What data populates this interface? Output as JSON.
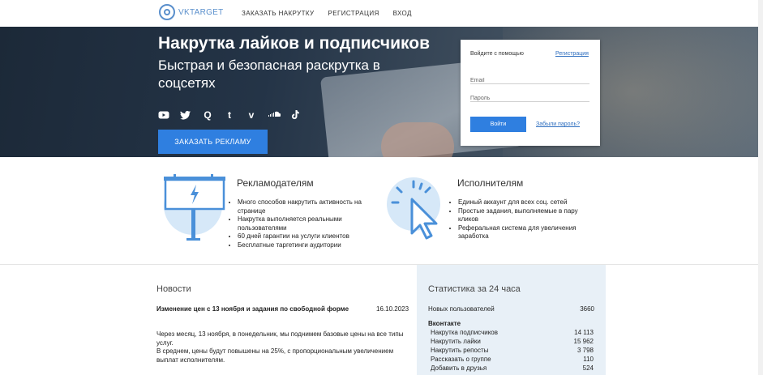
{
  "header": {
    "logo_text": "VKTARGET",
    "nav": [
      "ЗАКАЗАТЬ НАКРУТКУ",
      "РЕГИСТРАЦИЯ",
      "ВХОД"
    ]
  },
  "hero": {
    "title": "Накрутка лайков и подписчиков",
    "subtitle": "Быстрая и безопасная раскрутка в соцсетях",
    "socials": [
      "youtube-icon",
      "twitter-icon",
      "quora-icon",
      "tumblr-icon",
      "vimeo-icon",
      "soundcloud-icon",
      "tiktok-icon"
    ],
    "cta_label": "ЗАКАЗАТЬ РЕКЛАМУ"
  },
  "login": {
    "login_with": "Войдите с помощью",
    "register_link": "Регистрация",
    "email_placeholder": "Email",
    "password_placeholder": "Пароль",
    "submit_label": "Войти",
    "forgot_link": "Забыли пароль?"
  },
  "features": {
    "advertisers": {
      "heading": "Рекламодателям",
      "items": [
        "Много способов накрутить активность на странице",
        "Накрутка выполняется реальными пользователями",
        "60 дней гарантии на услуги клиентов",
        "Бесплатные таргетинги аудитории"
      ]
    },
    "performers": {
      "heading": "Исполнителям",
      "items": [
        "Единый аккаунт для всех соц. сетей",
        "Простые задания, выполняемые в пару кликов",
        "Реферальная система для увеличения заработка"
      ]
    }
  },
  "news": {
    "heading": "Новости",
    "title": "Изменение цен с 13 ноября и задания по свободной форме",
    "date": "16.10.2023",
    "body_1": "Через месяц, 13 ноября, в понедельник, мы поднимем базовые цены на все типы услуг.",
    "body_2": "В среднем, цены будут повышены на 25%, с пропорциональным увеличением выплат исполнителям."
  },
  "stats": {
    "heading": "Статистика за 24 часа",
    "new_users_label": "Новых пользователей",
    "new_users_value": "3660",
    "section": "Вконтакте",
    "rows": [
      {
        "label": "Накрутка подписчиков",
        "value": "14 113"
      },
      {
        "label": "Накрутить лайки",
        "value": "15 962"
      },
      {
        "label": "Накрутить репосты",
        "value": "3 798"
      },
      {
        "label": "Рассказать о группе",
        "value": "110"
      },
      {
        "label": "Добавить в друзья",
        "value": "524"
      }
    ]
  },
  "colors": {
    "accent": "#2f7fe0",
    "link": "#2f6fbf",
    "stats_bg": "#e8f0f7",
    "illustration": "#4a90d9"
  }
}
